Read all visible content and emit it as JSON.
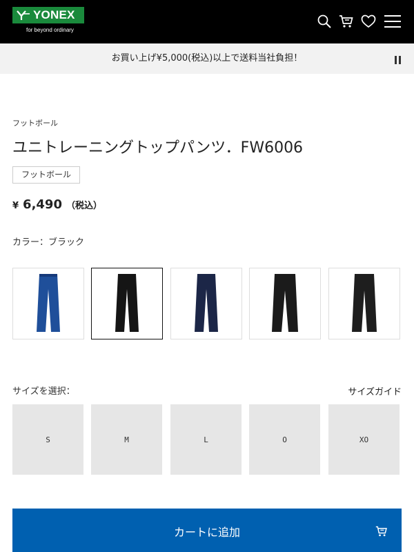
{
  "header": {
    "logo_text": "YONEX",
    "logo_tagline": "for beyond ordinary",
    "brand_color": "#1a8a3c",
    "icons": [
      "search-icon",
      "cart-icon",
      "heart-icon",
      "menu-icon"
    ]
  },
  "promo": {
    "text": "お買い上げ¥5,000(税込)以上で送料当社負担！",
    "control_icon": "pause-icon"
  },
  "product": {
    "category": "フットボール",
    "title": "ユニトレーニングトップパンツ．FW6006",
    "tag": "フットボール",
    "price_symbol": "¥",
    "price": "6,490",
    "price_tax": "（税込）",
    "color_label": "カラー：ブラック",
    "swatches": [
      {
        "color_name": "blue",
        "color": "#1f4f9a",
        "selected": false
      },
      {
        "color_name": "black",
        "color": "#151515",
        "selected": true
      },
      {
        "color_name": "navy",
        "color": "#1c2647",
        "selected": false
      },
      {
        "color_name": "black",
        "color": "#1b1b1b",
        "selected": false
      },
      {
        "color_name": "black",
        "color": "#1e1e1e",
        "selected": false
      }
    ]
  },
  "size": {
    "label": "サイズを選択：",
    "guide": "サイズガイド",
    "options": [
      "S",
      "M",
      "L",
      "O",
      "XO"
    ]
  },
  "cart": {
    "label": "カートに追加",
    "button_color": "#0060b0"
  }
}
